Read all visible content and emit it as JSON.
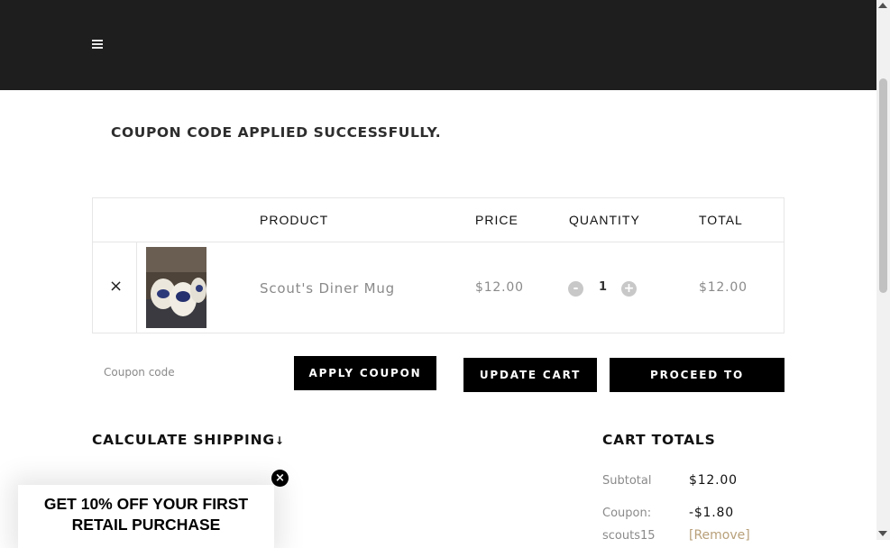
{
  "header": {
    "menu_icon": "hamburger-icon"
  },
  "notice": {
    "text": "COUPON CODE APPLIED SUCCESSFULLY."
  },
  "cart": {
    "columns": [
      "PRODUCT",
      "PRICE",
      "QUANTITY",
      "TOTAL"
    ],
    "items": [
      {
        "remove": "×",
        "name": "Scout's Diner Mug",
        "price": "$12.00",
        "quantity": "1",
        "minus": "-",
        "plus": "+",
        "total": "$12.00"
      }
    ]
  },
  "coupon": {
    "placeholder": "Coupon code",
    "apply_label": "APPLY COUPON"
  },
  "actions": {
    "update_label": "UPDATE CART",
    "checkout_label": "PROCEED TO CHECKOUT"
  },
  "shipping": {
    "title": "CALCULATE SHIPPING",
    "arrow": "↓"
  },
  "totals": {
    "title": "CART TOTALS",
    "subtotal_label": "Subtotal",
    "subtotal_value": "$12.00",
    "coupon_label": "Coupon:",
    "coupon_value": "-$1.80",
    "coupon_code": "scouts15",
    "remove_label": "[Remove]"
  },
  "promo": {
    "text": "GET 10% OFF YOUR FIRST RETAIL PURCHASE",
    "close": "×"
  },
  "colors": {
    "header_bg": "#1e1e1e",
    "button_bg": "#000000",
    "link": "#b8a07a",
    "muted": "#8a8a8a"
  }
}
